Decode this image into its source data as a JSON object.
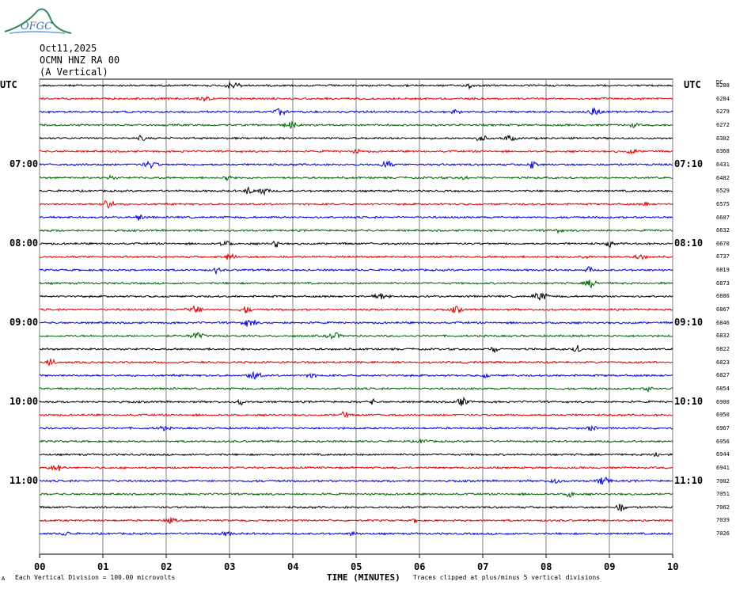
{
  "logo": {
    "text": "OFGC"
  },
  "header": {
    "date": "Oct11,2025",
    "station": "OCMN HNZ RA 00",
    "component": "(A Vertical)"
  },
  "axis": {
    "left_label": "UTC",
    "right_label": "UTC",
    "dc_label": "DC",
    "xlabel": "TIME (MINUTES)"
  },
  "footer": {
    "left_mark": "A",
    "scale_note": "Each Vertical Division =  100.00 microvolts",
    "clip_note": "Traces clipped at plus/minus 5 vertical divisions"
  },
  "colors": {
    "cycle": [
      "#000000",
      "#e00000",
      "#0000e0",
      "#006400"
    ],
    "grid": "#808080"
  },
  "chart_data": {
    "type": "line",
    "title": "",
    "xlabel": "TIME (MINUTES)",
    "ylabel": "",
    "x_range": [
      0,
      10
    ],
    "x_ticks": [
      "00",
      "01",
      "02",
      "03",
      "04",
      "05",
      "06",
      "07",
      "08",
      "09",
      "10"
    ],
    "grid": true,
    "left_time_labels": [
      {
        "row": 6,
        "label": "07:00"
      },
      {
        "row": 12,
        "label": "08:00"
      },
      {
        "row": 18,
        "label": "09:00"
      },
      {
        "row": 24,
        "label": "10:00"
      },
      {
        "row": 30,
        "label": "11:00"
      }
    ],
    "right_time_labels": [
      {
        "row": 6,
        "label": "07:10"
      },
      {
        "row": 12,
        "label": "08:10"
      },
      {
        "row": 18,
        "label": "09:10"
      },
      {
        "row": 24,
        "label": "10:10"
      },
      {
        "row": 30,
        "label": "11:10"
      }
    ],
    "trace_minutes": 10,
    "dc_values": [
      6288,
      6284,
      6279,
      6272,
      6302,
      6368,
      6431,
      6482,
      6529,
      6575,
      6607,
      6632,
      6670,
      6737,
      6819,
      6873,
      6886,
      6867,
      6846,
      6832,
      6822,
      6823,
      6827,
      6854,
      6900,
      6950,
      6967,
      6956,
      6944,
      6941,
      7002,
      7051,
      7062,
      7039,
      7026
    ]
  }
}
